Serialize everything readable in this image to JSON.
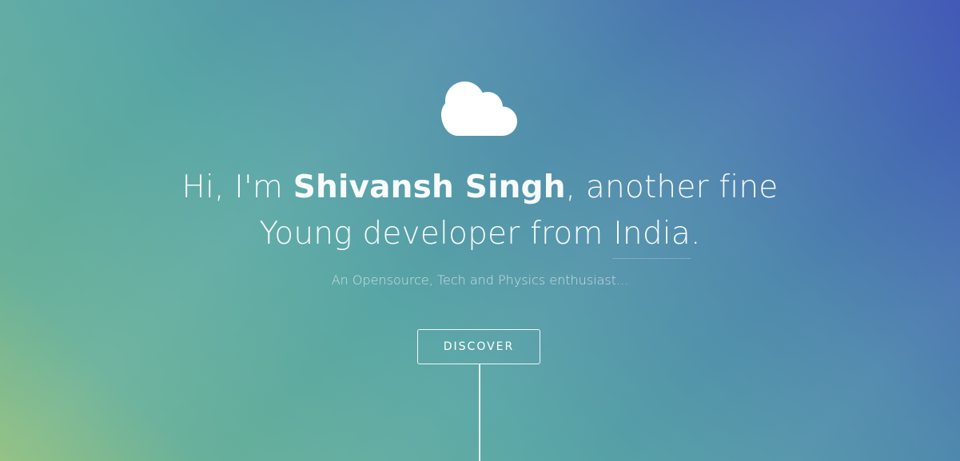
{
  "icon": {
    "name": "cloud-icon",
    "color": "#ffffff"
  },
  "headline": {
    "prefix": "Hi, I'm ",
    "name": "Shivansh Singh",
    "suffix": ", another fine",
    "line2_prefix": "Young developer from ",
    "country": "India",
    "line2_suffix": "."
  },
  "subtitle": "An Opensource, Tech and Physics enthusiast...",
  "cta": {
    "label": "DISCOVER"
  },
  "colors": {
    "gradient_bottom_left": "#8fbf7f",
    "gradient_mid": "#58a6a5",
    "gradient_top_right": "#3f56b6"
  }
}
